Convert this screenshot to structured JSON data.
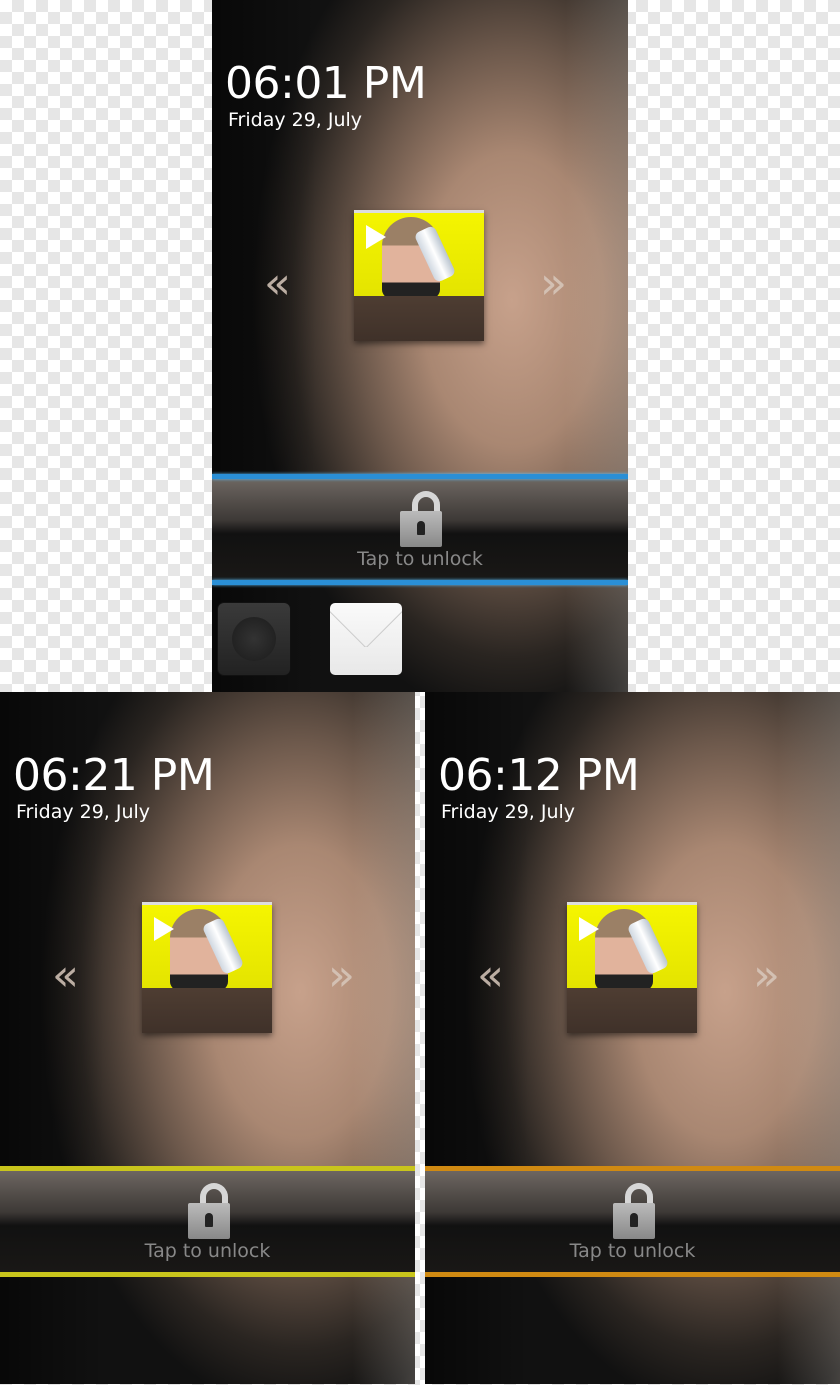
{
  "screens": [
    {
      "time": "06:01 PM",
      "date": "Friday 29, July",
      "unlock_label": "Tap to unlock",
      "accent": "#2a8fd6",
      "prev_icon": "«",
      "next_icon": "»"
    },
    {
      "time": "06:21 PM",
      "date": "Friday 29, July",
      "unlock_label": "Tap to unlock",
      "accent": "#c9c51c",
      "prev_icon": "«",
      "next_icon": "»"
    },
    {
      "time": "06:12 PM",
      "date": "Friday 29, July",
      "unlock_label": "Tap to unlock",
      "accent": "#d08a12",
      "prev_icon": "«",
      "next_icon": "»"
    }
  ],
  "dock": {
    "items": [
      "phone-icon",
      "mail-icon"
    ]
  }
}
